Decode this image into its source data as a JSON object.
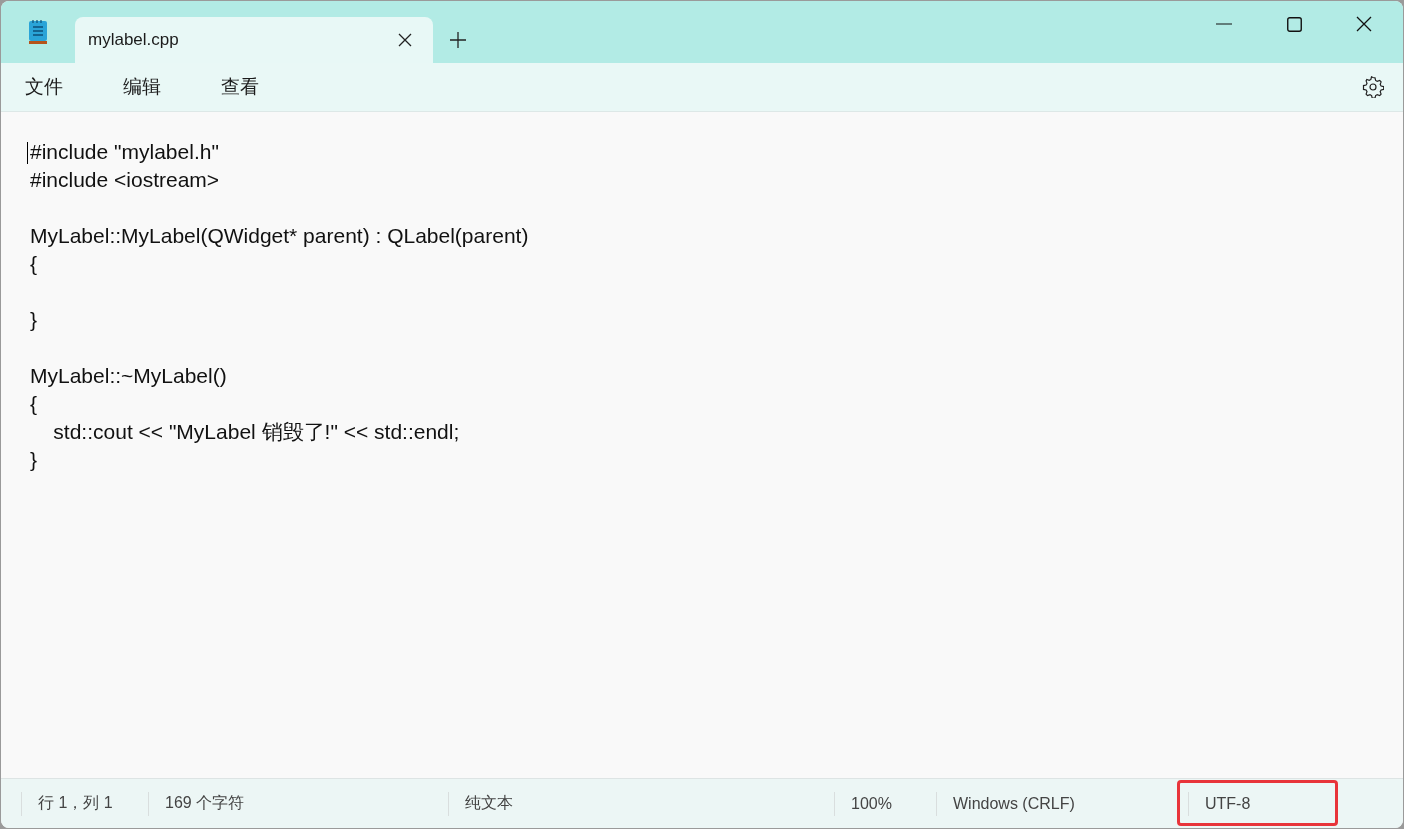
{
  "tabs": [
    {
      "label": "mylabel.cpp",
      "selected": true
    }
  ],
  "menu": [
    "文件",
    "编辑",
    "查看"
  ],
  "editor": {
    "text": "#include \"mylabel.h\"\n#include <iostream>\n\nMyLabel::MyLabel(QWidget* parent) : QLabel(parent)\n{\n\n}\n\nMyLabel::~MyLabel()\n{\n    std::cout << \"MyLabel 销毁了!\" << std::endl;\n}"
  },
  "status_bar": {
    "items": [
      {
        "text": "行 1，列 1",
        "highlighted": false
      },
      {
        "text": "169 个字符",
        "highlighted": false
      },
      {
        "text": "纯文本",
        "highlighted": false
      },
      {
        "text": "100%",
        "highlighted": false
      },
      {
        "text": "Windows (CRLF)",
        "highlighted": false
      },
      {
        "text": "UTF-8",
        "highlighted": true
      }
    ]
  }
}
